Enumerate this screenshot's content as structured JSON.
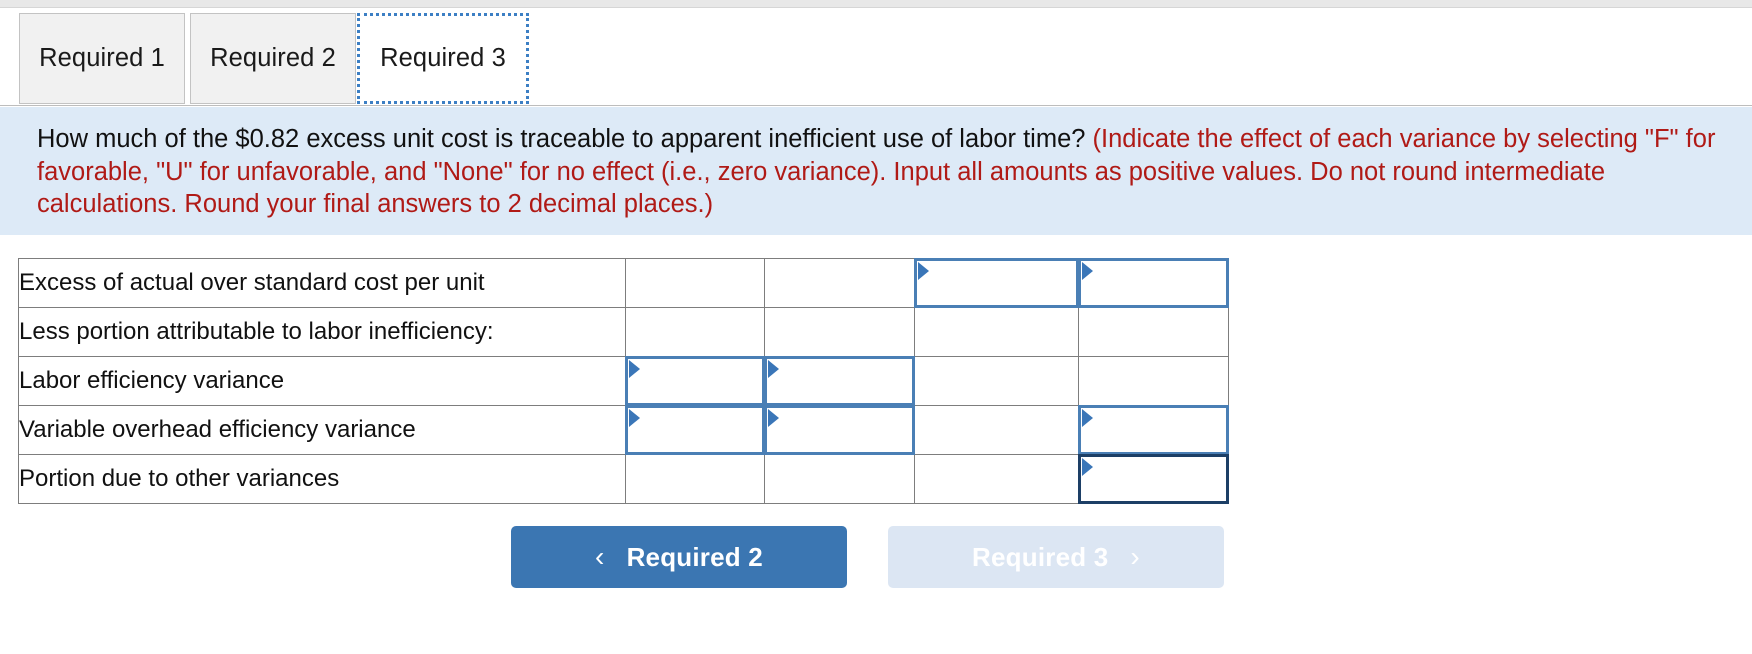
{
  "tabs": [
    {
      "label": "Required 1",
      "active": false
    },
    {
      "label": "Required 2",
      "active": false
    },
    {
      "label": "Required 3",
      "active": true
    }
  ],
  "instructions": {
    "question": "How much of the $0.82 excess unit cost is traceable to apparent inefficient use of labor time?",
    "note": "(Indicate the effect of each variance by selecting \"F\" for favorable, \"U\" for unfavorable, and \"None\" for no effect (i.e., zero variance). Input all amounts as positive values. Do not round intermediate calculations. Round your final answers to 2 decimal places.)",
    "note_color": "#b01a16",
    "background_color": "#ddeaf7"
  },
  "table": {
    "rows": [
      {
        "label": "Excess of actual over standard cost per unit",
        "cells": [
          {
            "input": false,
            "value": ""
          },
          {
            "input": false,
            "value": ""
          },
          {
            "input": true,
            "value": "",
            "style": "normal"
          },
          {
            "input": true,
            "value": "",
            "style": "normal"
          }
        ]
      },
      {
        "label": "Less portion attributable to labor inefficiency:",
        "cells": [
          {
            "input": false,
            "value": ""
          },
          {
            "input": false,
            "value": ""
          },
          {
            "input": false,
            "value": ""
          },
          {
            "input": false,
            "value": ""
          }
        ]
      },
      {
        "label": "Labor efficiency variance",
        "cells": [
          {
            "input": true,
            "value": "",
            "style": "normal"
          },
          {
            "input": true,
            "value": "",
            "style": "normal"
          },
          {
            "input": false,
            "value": ""
          },
          {
            "input": false,
            "value": ""
          }
        ]
      },
      {
        "label": "Variable overhead efficiency variance",
        "cells": [
          {
            "input": true,
            "value": "",
            "style": "normal"
          },
          {
            "input": true,
            "value": "",
            "style": "normal"
          },
          {
            "input": false,
            "value": ""
          },
          {
            "input": true,
            "value": "",
            "style": "normal"
          }
        ]
      },
      {
        "label": "Portion due to other variances",
        "cells": [
          {
            "input": false,
            "value": ""
          },
          {
            "input": false,
            "value": ""
          },
          {
            "input": false,
            "value": ""
          },
          {
            "input": true,
            "value": "",
            "style": "dark"
          }
        ]
      }
    ]
  },
  "nav": {
    "prev_label": "Required 2",
    "prev_icon": "chevron-left-icon",
    "prev_color": "#3b76b2",
    "next_label": "Required 3",
    "next_icon": "chevron-right-icon",
    "next_color": "#dce6f3",
    "next_disabled": true
  },
  "glyphs": {
    "chevron_left": "‹",
    "chevron_right": "›"
  }
}
